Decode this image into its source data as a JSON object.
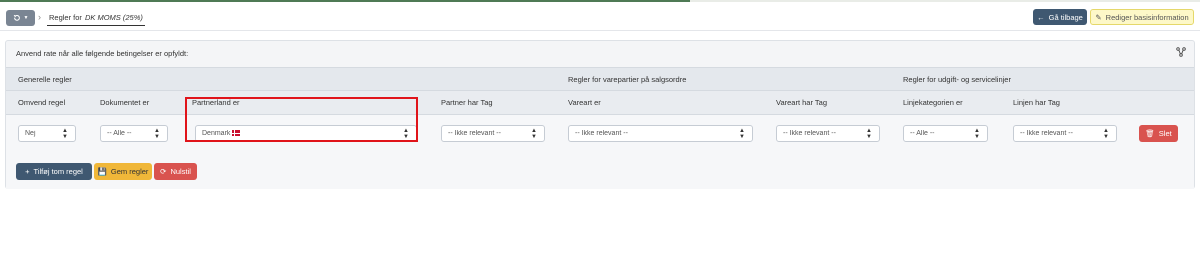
{
  "toolbar": {
    "history_icon": "history-icon",
    "breadcrumb_prefix": "Regler for",
    "breadcrumb_name": "DK MOMS (25%)",
    "back_label": "Gå tilbage",
    "edit_label": "Rediger basisinformation"
  },
  "panel": {
    "title": "Anvend rate når alle følgende betingelser er opfyldt:",
    "groups": {
      "general": "Generelle regler",
      "item": "Regler for varepartier på salgsordre",
      "expense": "Regler for udgift- og servicelinjer"
    },
    "columns": {
      "reverse": "Omvend regel",
      "document": "Dokumentet er",
      "partner_country": "Partnerland er",
      "partner_tag": "Partner har Tag",
      "item_type": "Vareart er",
      "item_type_tag": "Vareart har Tag",
      "line_category": "Linjekategorien er",
      "line_tag": "Linjen har Tag"
    },
    "row": {
      "reverse": "Nej",
      "document": "-- Alle --",
      "partner_country": "Denmark",
      "partner_tag": "-- Ikke relevant --",
      "item_type": "-- Ikke relevant --",
      "item_type_tag": "-- Ikke relevant --",
      "line_category": "-- Alle --",
      "line_tag": "-- Ikke relevant --",
      "delete_label": "Slet"
    },
    "actions": {
      "add_label": "Tilføj tom regel",
      "save_label": "Gem regler",
      "reset_label": "Nulstil"
    }
  },
  "colors": {
    "primary": "#3f5871",
    "warning": "#f0b739",
    "danger": "#d9534f",
    "highlight": "#e0141a"
  }
}
